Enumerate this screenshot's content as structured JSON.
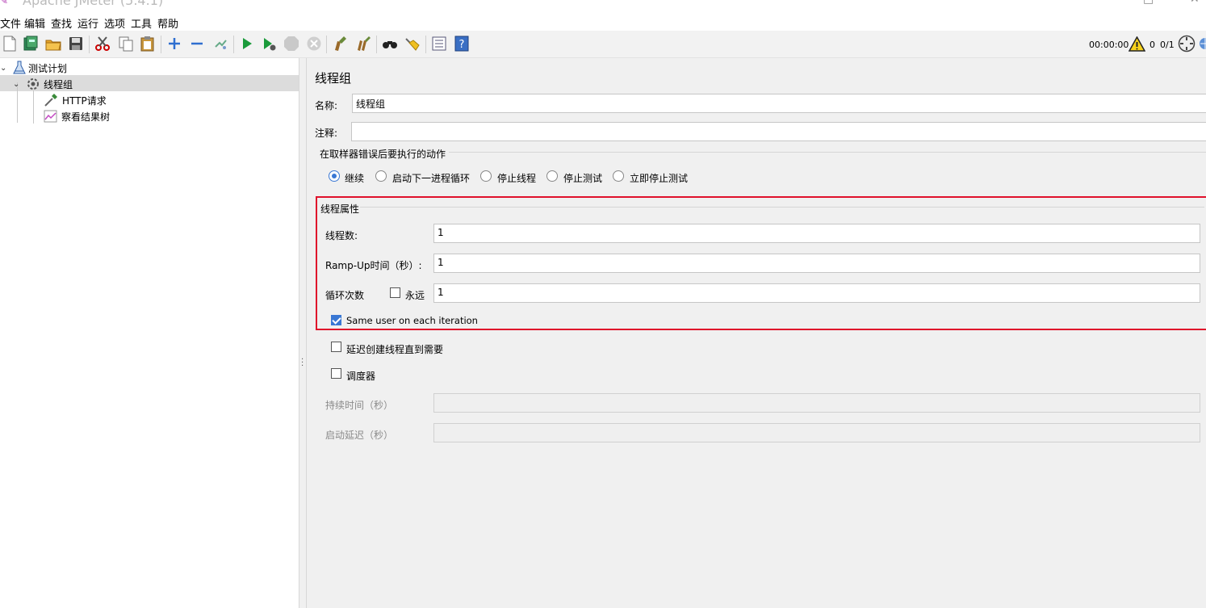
{
  "window": {
    "title": "Apache JMeter (5.4.1)"
  },
  "menu": [
    "文件",
    "编辑",
    "查找",
    "运行",
    "选项",
    "工具",
    "帮助"
  ],
  "toolbar": {
    "timer": "00:00:00",
    "warning_count": "0",
    "threads": "0/1"
  },
  "tree": {
    "root": "测试计划",
    "thread_group": "线程组",
    "http_request": "HTTP请求",
    "results_tree": "察看结果树"
  },
  "editor": {
    "title": "线程组",
    "name_label": "名称:",
    "name_value": "线程组",
    "comment_label": "注释:",
    "comment_value": "",
    "error_action": {
      "title": "在取样器错误后要执行的动作",
      "options": [
        "继续",
        "启动下一进程循环",
        "停止线程",
        "停止测试",
        "立即停止测试"
      ],
      "selected": "继续"
    },
    "thread_props": {
      "title": "线程属性",
      "threads_label": "线程数:",
      "threads_value": "1",
      "rampup_label": "Ramp-Up时间（秒）:",
      "rampup_value": "1",
      "loop_label": "循环次数",
      "forever_label": "永远",
      "forever_checked": false,
      "loop_value": "1",
      "same_user_label": "Same user on each iteration",
      "same_user_checked": true
    },
    "delay_create_label": "延迟创建线程直到需要",
    "delay_create_checked": false,
    "scheduler_label": "调度器",
    "scheduler_checked": false,
    "duration_label": "持续时间（秒）",
    "duration_value": "",
    "startup_delay_label": "启动延迟（秒）",
    "startup_delay_value": ""
  },
  "colors": {
    "highlight": "#e0112b",
    "accent": "#3a78d4"
  }
}
